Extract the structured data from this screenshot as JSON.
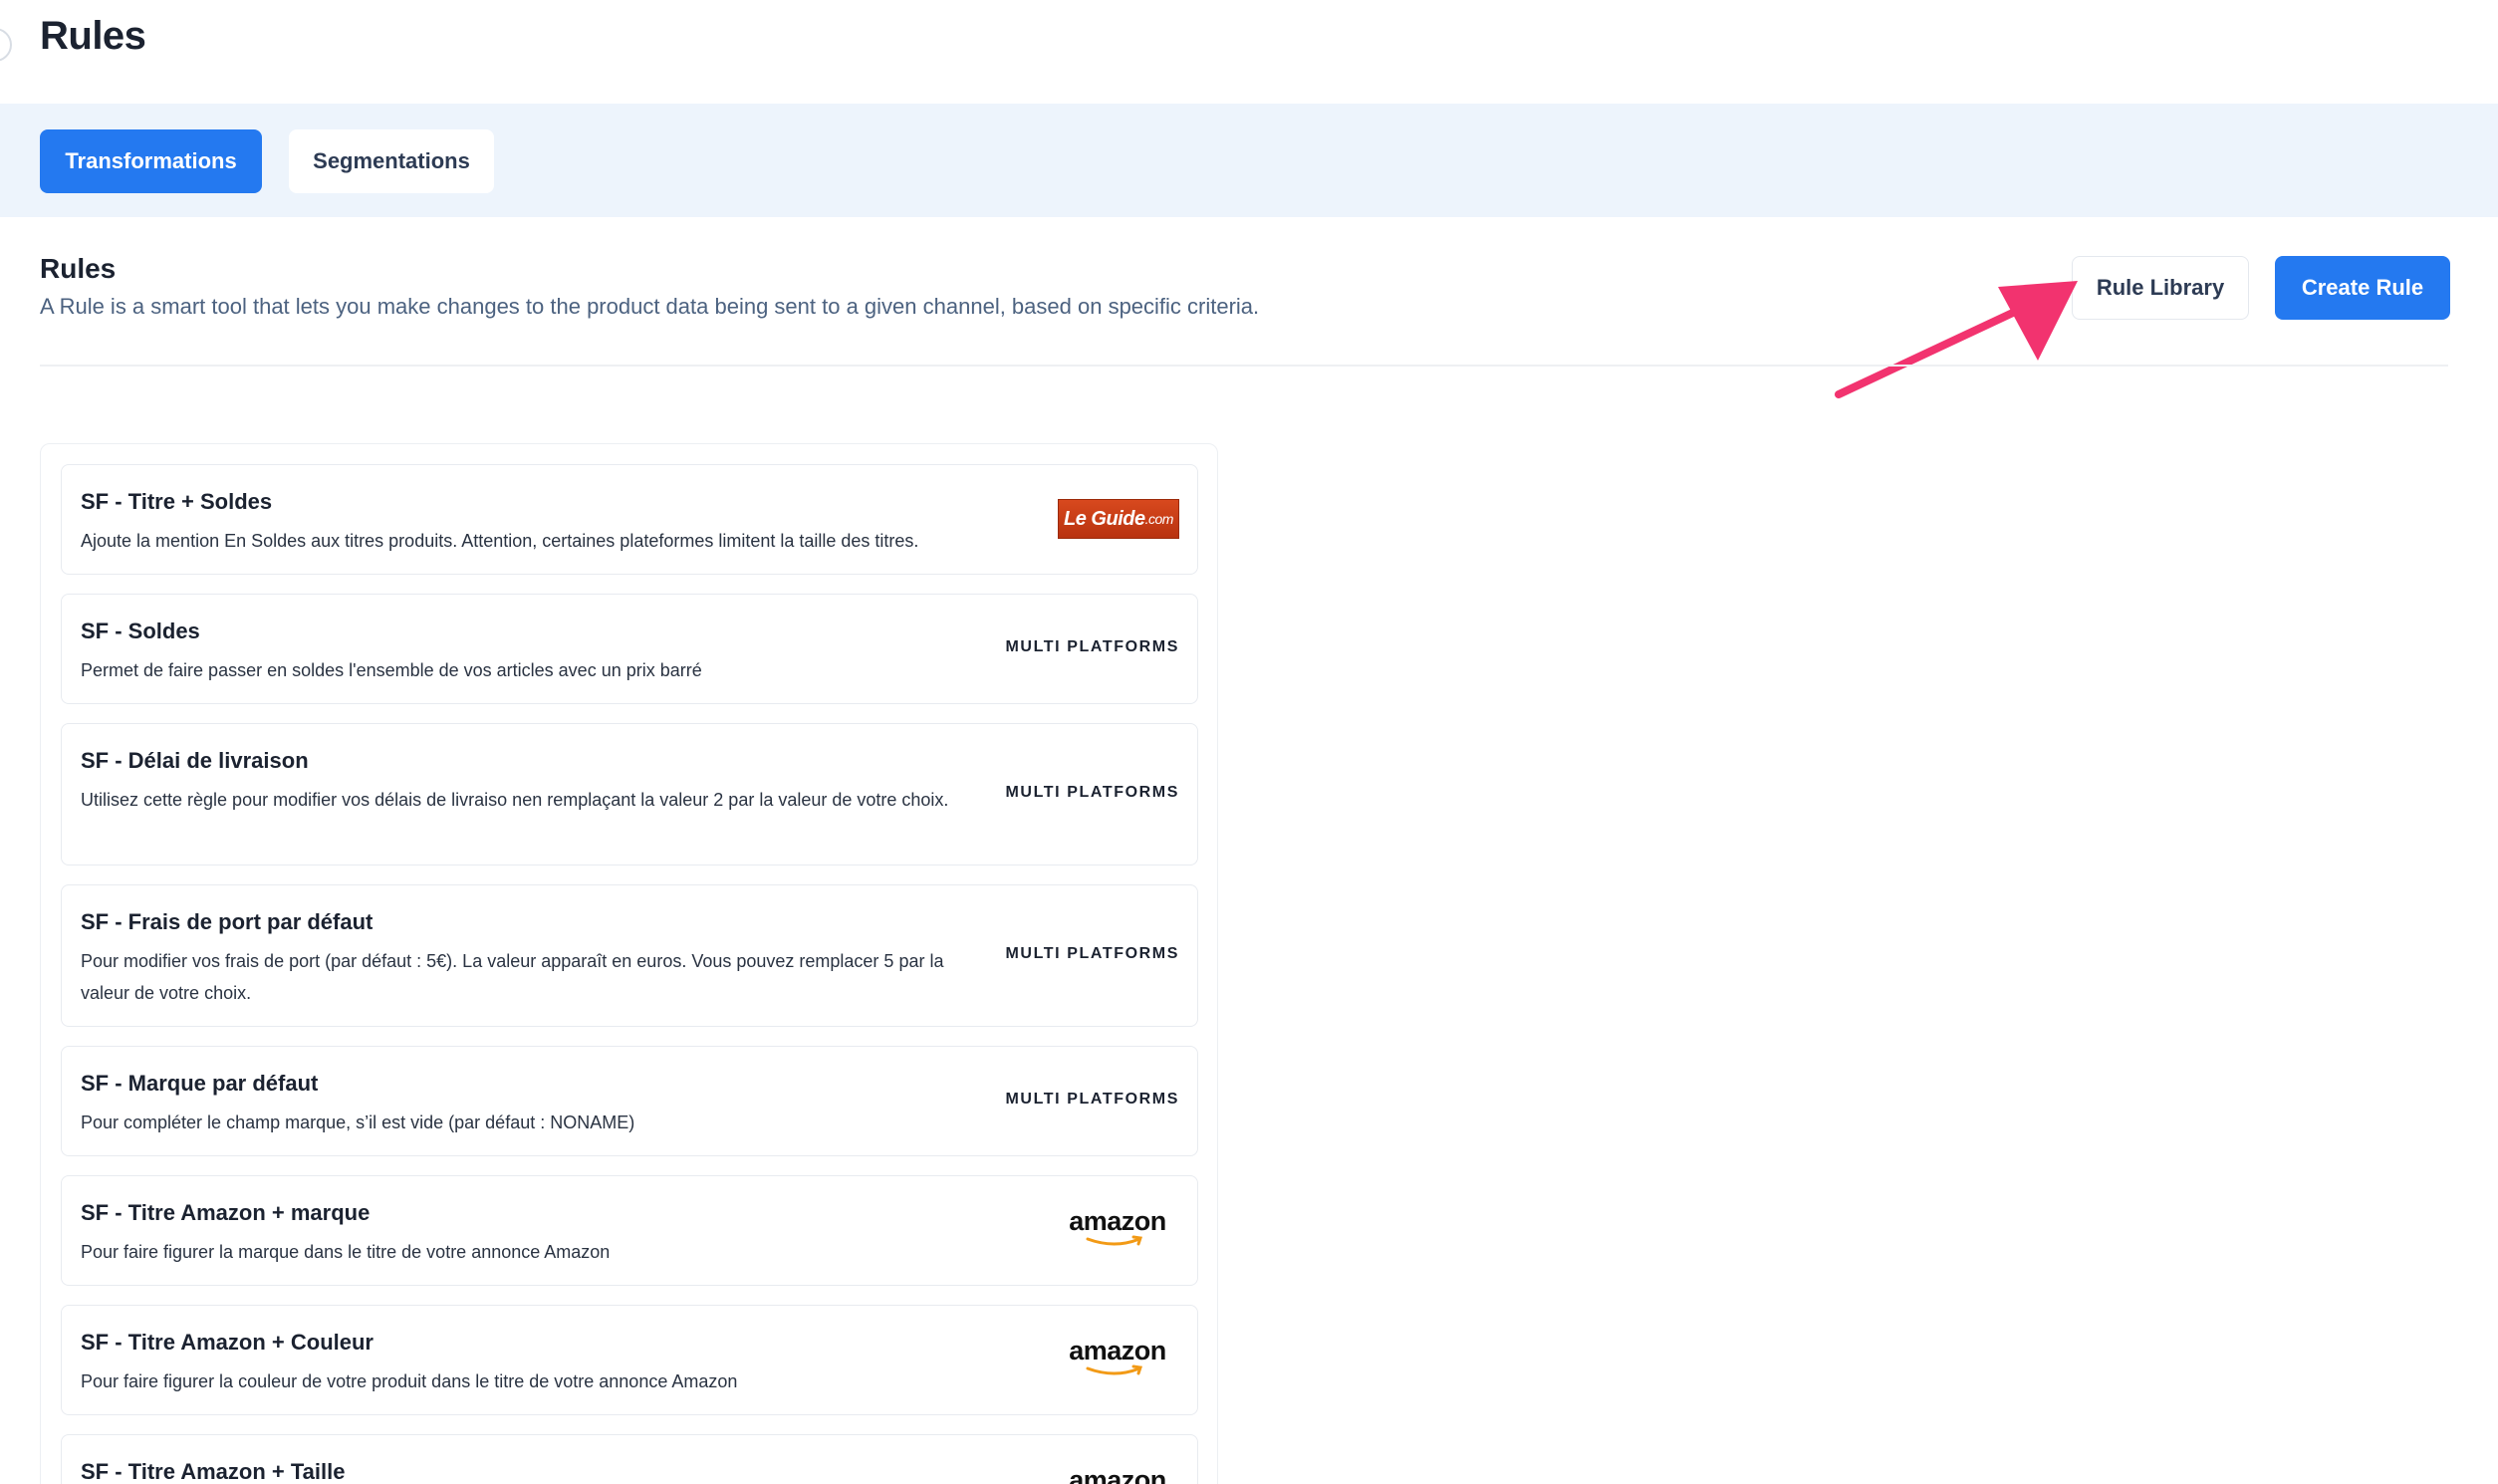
{
  "header": {
    "title": "Rules"
  },
  "tabs": [
    {
      "label": "Transformations",
      "active": true
    },
    {
      "label": "Segmentations",
      "active": false
    }
  ],
  "section": {
    "title": "Rules",
    "description": "A Rule is a smart tool that lets you make changes to the product data being sent to a given channel, based on specific criteria."
  },
  "actions": {
    "library_label": "Rule Library",
    "create_label": "Create Rule"
  },
  "colors": {
    "accent": "#2479f0",
    "band": "#edf4fc",
    "arrow": "#f2336f"
  },
  "rules": [
    {
      "name": "SF - Titre + Soldes",
      "description": "Ajoute la mention En Soldes aux titres produits. Attention, certaines plateformes limitent la taille des titres.",
      "platform": "LeGuide.com",
      "platform_icon": "leguide-logo"
    },
    {
      "name": "SF - Soldes",
      "description": "Permet de faire passer en soldes l'ensemble de vos articles avec un prix barré",
      "platform": "MULTI PLATFORMS"
    },
    {
      "name": "SF - Délai de livraison",
      "description": "Utilisez cette règle pour modifier vos délais de livraiso nen remplaçant la valeur 2 par la valeur de votre choix.",
      "platform": "MULTI PLATFORMS"
    },
    {
      "name": "SF - Frais de port par défaut",
      "description": "Pour modifier vos frais de port (par défaut : 5€). La valeur apparaît en euros. Vous pouvez remplacer 5 par la valeur de votre choix.",
      "platform": "MULTI PLATFORMS"
    },
    {
      "name": "SF - Marque par défaut",
      "description": "Pour compléter le champ marque, s’il est vide (par défaut : NONAME)",
      "platform": "MULTI PLATFORMS"
    },
    {
      "name": "SF - Titre Amazon + marque",
      "description": "Pour faire figurer la marque dans le titre de votre annonce Amazon",
      "platform": "amazon",
      "platform_icon": "amazon-logo"
    },
    {
      "name": "SF - Titre Amazon + Couleur",
      "description": "Pour faire figurer la couleur de votre produit dans le titre de votre annonce Amazon",
      "platform": "amazon",
      "platform_icon": "amazon-logo"
    },
    {
      "name": "SF - Titre Amazon + Taille",
      "description": "",
      "platform": "amazon",
      "platform_icon": "amazon-logo"
    }
  ]
}
